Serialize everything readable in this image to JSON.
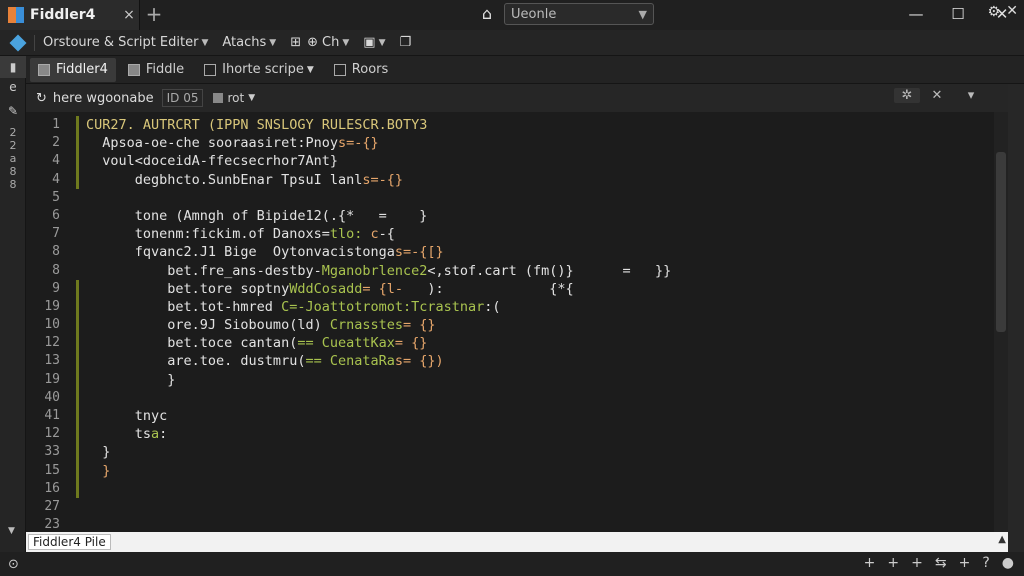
{
  "window": {
    "tab_title": "Fiddler4",
    "tab_close": "×",
    "new_tab": "+",
    "search_value": "Ueonle",
    "minimize": "—",
    "maximize": "☐",
    "close": "✕"
  },
  "toolbar": {
    "items": [
      "Orstoure & Script Editer",
      "Atachs",
      "Ch"
    ]
  },
  "leftbar": {
    "top_label": "e",
    "vertical_text": "2 2 a 8 8"
  },
  "doctabs": [
    "Fiddler4",
    "Fiddle",
    "Ihorte scripe",
    "Roors"
  ],
  "editor_header": {
    "name": "here wgoonabe",
    "field1": "ID 05",
    "field2": "rot"
  },
  "gutter": [
    "1",
    "2",
    "4",
    "4",
    "5",
    "6",
    "7",
    "8",
    "8",
    "9",
    "19",
    "10",
    "12",
    "13",
    "19",
    "40",
    "41",
    "12",
    "33",
    "15",
    "16",
    "27",
    "23"
  ],
  "code_lines": [
    [
      [
        "y",
        "CUR27. AUTRCRT (IPPN SNSLOGY RULESCR.BOTY3"
      ]
    ],
    [
      [
        "w",
        "  Apsoa-oe-che sooraasiret:Pnoy"
      ],
      [
        "o",
        "s=-{}"
      ]
    ],
    [
      [
        "w",
        "  voul<doceidA-ffecsecrhor7Ant}"
      ]
    ],
    [
      [
        "w",
        "      degbhcto.SunbEnar TpsuI lanl"
      ],
      [
        "o",
        "s=-{}"
      ]
    ],
    [
      [
        "w",
        ""
      ]
    ],
    [
      [
        "w",
        "      tone (Amngh of Bipide12(.{*   =    }"
      ]
    ],
    [
      [
        "w",
        "      tonenm:fickim.of Danoxs="
      ],
      [
        "g",
        "tlo: "
      ],
      [
        "o",
        "c"
      ],
      [
        "w",
        "-{"
      ]
    ],
    [
      [
        "w",
        "      fqvanc2.J1 Bige  Oytonvacistonga"
      ],
      [
        "o",
        "s=-{[}"
      ]
    ],
    [
      [
        "w",
        "          bet.fre_ans-destby-"
      ],
      [
        "g",
        "Mganobrlence2"
      ],
      [
        "w",
        "<,stof.cart (fm()}      =   }}"
      ]
    ],
    [
      [
        "w",
        "          bet.tore soptny"
      ],
      [
        "g",
        "WddCosadd"
      ],
      [
        "o",
        "= {l-"
      ],
      [
        "w",
        "   ):             {*{"
      ]
    ],
    [
      [
        "w",
        "          bet.tot-hmred "
      ],
      [
        "g",
        "C=-Joattotromot:Tcrastnar"
      ],
      [
        "w",
        ":("
      ]
    ],
    [
      [
        "w",
        "          ore.9J Sioboumo(ld) "
      ],
      [
        "g",
        "Crnasstes"
      ],
      [
        "o",
        "= {}"
      ]
    ],
    [
      [
        "w",
        "          bet.toce cantan("
      ],
      [
        "g",
        "== CueattKax"
      ],
      [
        "o",
        "= {}"
      ]
    ],
    [
      [
        "w",
        "          are.toe. dustmru("
      ],
      [
        "g",
        "== CenataRa"
      ],
      [
        "o",
        "s= {})"
      ]
    ],
    [
      [
        "w",
        "          }"
      ]
    ],
    [
      [
        "w",
        ""
      ]
    ],
    [
      [
        "w",
        "      tnyc"
      ]
    ],
    [
      [
        "w",
        "      ts"
      ],
      [
        "g",
        "a"
      ],
      [
        "w",
        ":"
      ]
    ],
    [
      [
        "w",
        "  }"
      ]
    ],
    [
      [
        "o",
        "  }"
      ]
    ],
    [
      [
        "w",
        ""
      ]
    ],
    [
      [
        "w",
        ""
      ]
    ],
    [
      [
        "w",
        ""
      ]
    ]
  ],
  "change_marks": [
    true,
    true,
    true,
    true,
    false,
    false,
    false,
    false,
    false,
    true,
    true,
    true,
    true,
    true,
    true,
    true,
    true,
    true,
    true,
    true,
    true,
    false,
    false
  ],
  "hscroll_label": "Fiddler4 Pile",
  "status": {
    "left": "⊙",
    "right": [
      "+",
      "+",
      "+",
      "⇆",
      "+",
      "?",
      "●"
    ]
  }
}
